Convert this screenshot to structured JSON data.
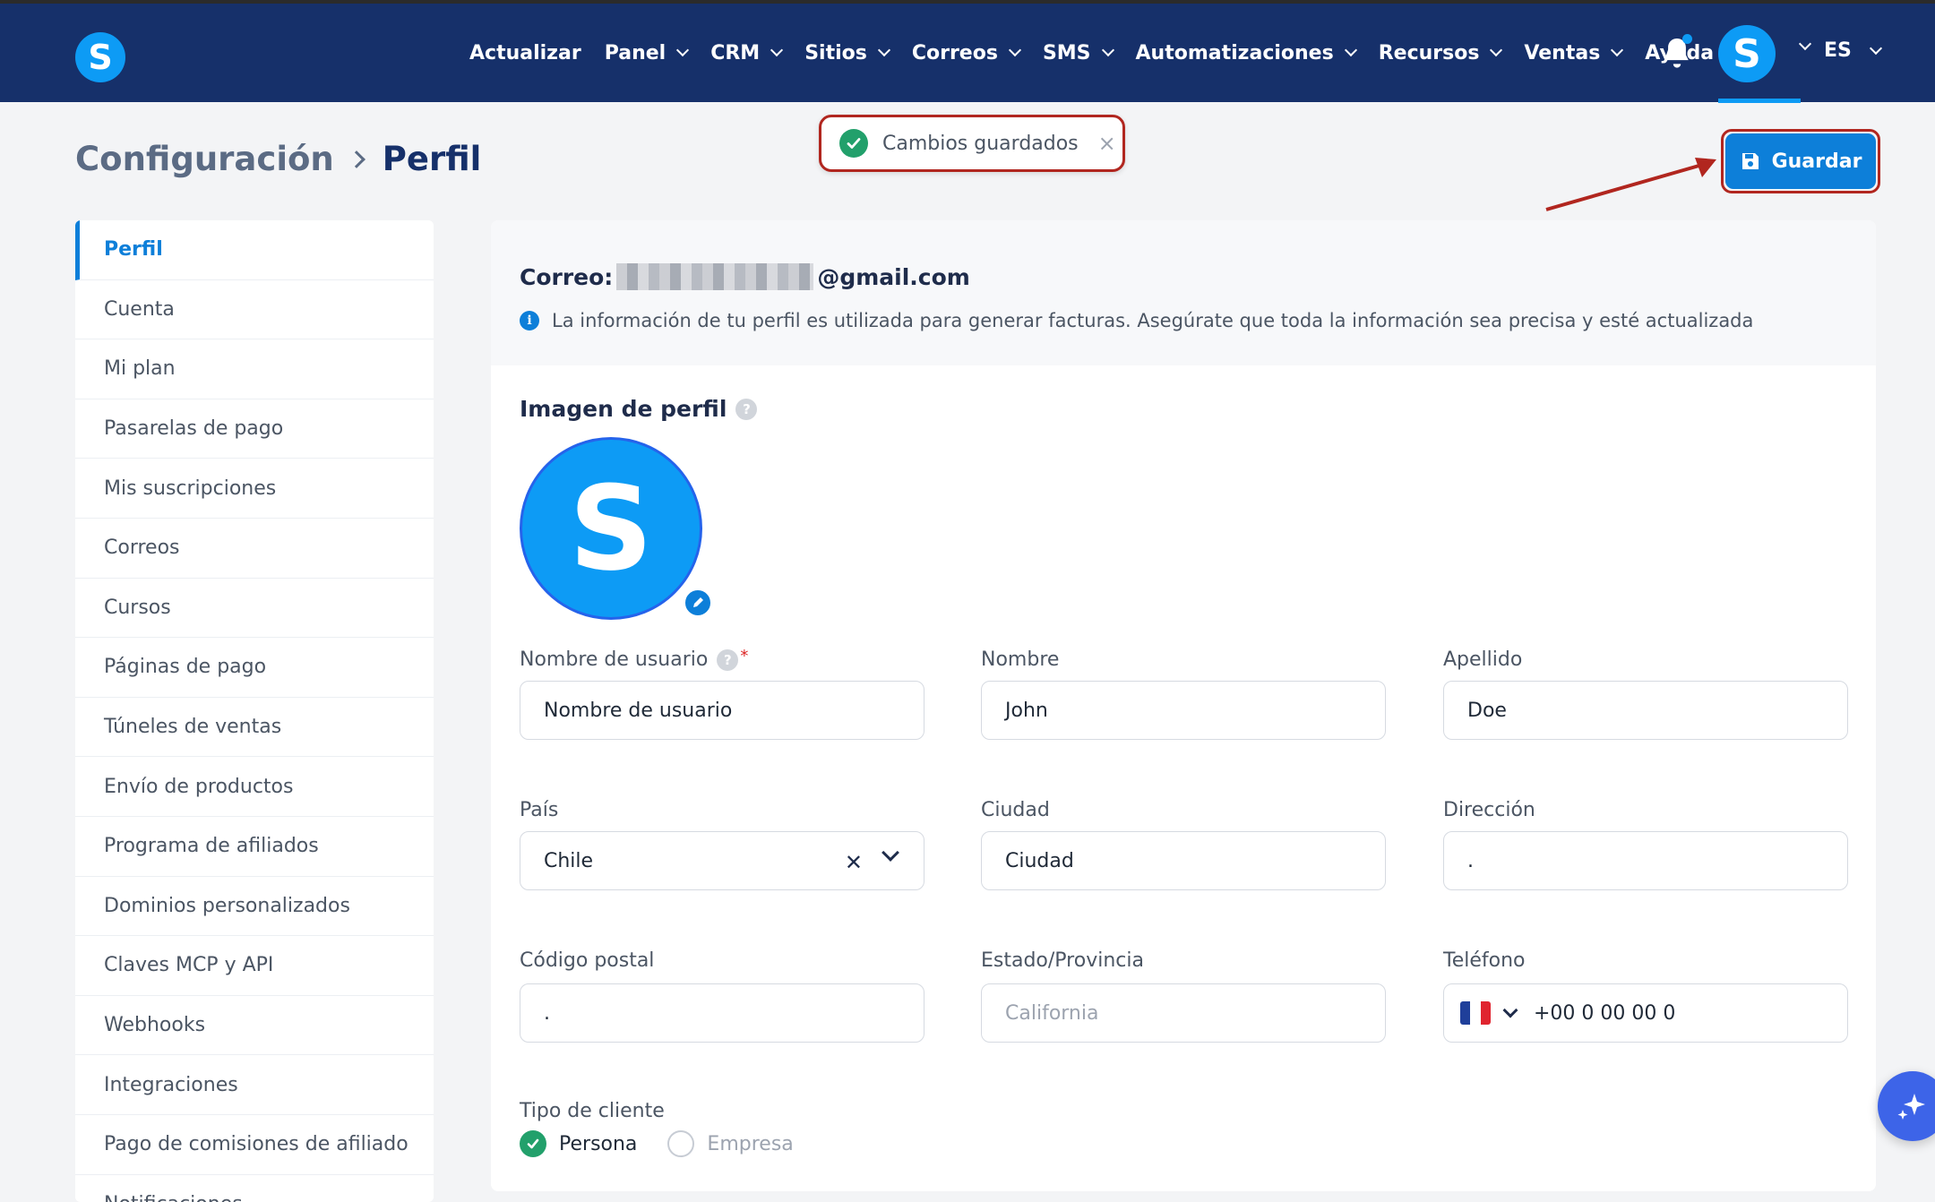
{
  "nav": {
    "logo_letter": "S",
    "items": [
      {
        "label": "Actualizar",
        "dropdown": false
      },
      {
        "label": "Panel",
        "dropdown": true
      },
      {
        "label": "CRM",
        "dropdown": true
      },
      {
        "label": "Sitios",
        "dropdown": true
      },
      {
        "label": "Correos",
        "dropdown": true
      },
      {
        "label": "SMS",
        "dropdown": true
      },
      {
        "label": "Automatizaciones",
        "dropdown": true
      },
      {
        "label": "Recursos",
        "dropdown": true
      },
      {
        "label": "Ventas",
        "dropdown": true
      },
      {
        "label": "Ayuda",
        "dropdown": false
      }
    ],
    "avatar_letter": "S",
    "language": "ES",
    "accent_color": "#0d9bf5",
    "bg_color": "#16306a"
  },
  "breadcrumb": {
    "parent": "Configuración",
    "current": "Perfil"
  },
  "toast": {
    "message": "Cambios guardados",
    "close": "×"
  },
  "save_button": {
    "label": "Guardar"
  },
  "sidebar": {
    "items": [
      {
        "label": "Perfil",
        "active": true
      },
      {
        "label": "Cuenta"
      },
      {
        "label": "Mi plan"
      },
      {
        "label": "Pasarelas de pago"
      },
      {
        "label": "Mis suscripciones"
      },
      {
        "label": "Correos"
      },
      {
        "label": "Cursos"
      },
      {
        "label": "Páginas de pago"
      },
      {
        "label": "Túneles de ventas"
      },
      {
        "label": "Envío de productos"
      },
      {
        "label": "Programa de afiliados"
      },
      {
        "label": "Dominios personalizados"
      },
      {
        "label": "Claves MCP y API"
      },
      {
        "label": "Webhooks"
      },
      {
        "label": "Integraciones"
      },
      {
        "label": "Pago de comisiones de afiliado"
      },
      {
        "label": "Notificaciones"
      }
    ]
  },
  "profile": {
    "email_label": "Correo:",
    "email_domain": "@gmail.com",
    "info_text": "La información de tu perfil es utilizada para generar facturas. Asegúrate que toda la información sea precisa y esté actualizada",
    "image_title": "Imagen de perfil",
    "avatar_letter": "S"
  },
  "fields": {
    "username": {
      "label": "Nombre de usuario",
      "value": "Nombre de usuario",
      "required_mark": "*"
    },
    "first_name": {
      "label": "Nombre",
      "value": "John"
    },
    "last_name": {
      "label": "Apellido",
      "value": "Doe"
    },
    "country": {
      "label": "País",
      "value": "Chile"
    },
    "city": {
      "label": "Ciudad",
      "value": "Ciudad"
    },
    "address": {
      "label": "Dirección",
      "value": "."
    },
    "postal_code": {
      "label": "Código postal",
      "value": "."
    },
    "state": {
      "label": "Estado/Provincia",
      "placeholder": "California"
    },
    "phone": {
      "label": "Teléfono",
      "value": "+00 0 00 00 0",
      "flag": "France"
    }
  },
  "customer_type": {
    "label": "Tipo de cliente",
    "options": [
      {
        "label": "Persona",
        "selected": true
      },
      {
        "label": "Empresa",
        "selected": false
      }
    ]
  }
}
